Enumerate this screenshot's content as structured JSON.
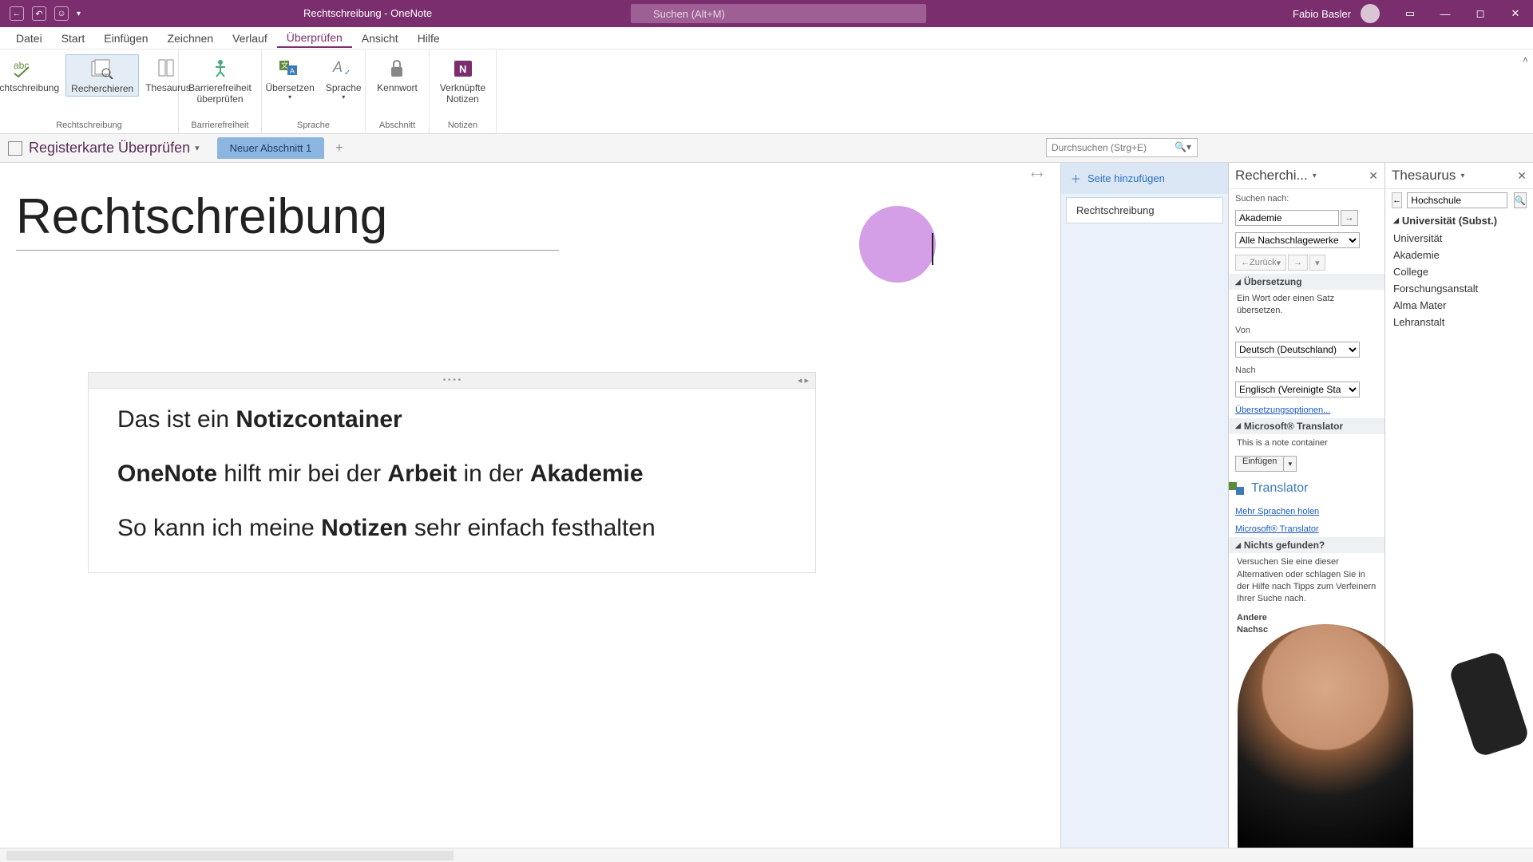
{
  "titlebar": {
    "doc_title": "Rechtschreibung  -  OneNote",
    "search_placeholder": "Suchen (Alt+M)",
    "user": "Fabio Basler"
  },
  "menus": [
    "Datei",
    "Start",
    "Einfügen",
    "Zeichnen",
    "Verlauf",
    "Überprüfen",
    "Ansicht",
    "Hilfe"
  ],
  "menu_active_index": 5,
  "ribbon": {
    "spelling": {
      "btns": [
        {
          "label": "Rechtschreibung"
        },
        {
          "label": "Recherchieren",
          "selected": true
        },
        {
          "label": "Thesaurus"
        }
      ],
      "group": "Rechtschreibung"
    },
    "accessibility": {
      "label": "Barrierefreiheit\nüberprüfen",
      "group": "Barrierefreiheit"
    },
    "language": {
      "btns": [
        "Übersetzen",
        "Sprache"
      ],
      "group": "Sprache"
    },
    "section": {
      "label": "Kennwort",
      "group": "Abschnitt"
    },
    "notes": {
      "label": "Verknüpfte\nNotizen",
      "group": "Notizen"
    }
  },
  "notebook": {
    "name": "Registerkarte Überprüfen",
    "section_tab": "Neuer Abschnitt 1",
    "search_placeholder": "Durchsuchen (Strg+E)"
  },
  "page": {
    "title": "Rechtschreibung",
    "add_page": "Seite hinzufügen",
    "page_list_item": "Rechtschreibung"
  },
  "note": {
    "line1_a": "Das ist ein ",
    "line1_b": "Notizcontainer",
    "line2_a": "OneNote",
    "line2_b": " hilft mir bei der ",
    "line2_c": "Arbeit",
    "line2_d": " in der ",
    "line2_e": "Akademie",
    "line3_a": "So kann ich meine ",
    "line3_b": "Notizen",
    "line3_c": " sehr einfach festhalten"
  },
  "research": {
    "title": "Recherchi...",
    "search_label": "Suchen nach:",
    "search_value": "Akademie",
    "scope": "Alle Nachschlagewerke",
    "back": "Zurück",
    "sec_translation": "Übersetzung",
    "trans_hint": "Ein Wort oder einen Satz übersetzen.",
    "from_label": "Von",
    "from_value": "Deutsch (Deutschland)",
    "to_label": "Nach",
    "to_value": "Englisch (Vereinigte Sta",
    "trans_options": "Übersetzungsoptionen...",
    "sec_translator": "Microsoft® Translator",
    "trans_note": "This is a note container",
    "insert": "Einfügen",
    "translator_logo": "Translator",
    "more_languages": "Mehr Sprachen holen",
    "ms_translator_link": "Microsoft® Translator",
    "sec_notfound": "Nichts gefunden?",
    "notfound_body": "Versuchen Sie eine dieser Alternativen oder schlagen Sie in der Hilfe nach Tipps zum Verfeinern Ihrer Suche nach.",
    "other": "Andere",
    "other2": "Nachsc"
  },
  "thesaurus": {
    "title": "Thesaurus",
    "search_value": "Hochschule",
    "heading": "Universität (Subst.)",
    "items": [
      "Universität",
      "Akademie",
      "College",
      "Forschungsanstalt",
      "Alma Mater",
      "Lehranstalt"
    ]
  }
}
